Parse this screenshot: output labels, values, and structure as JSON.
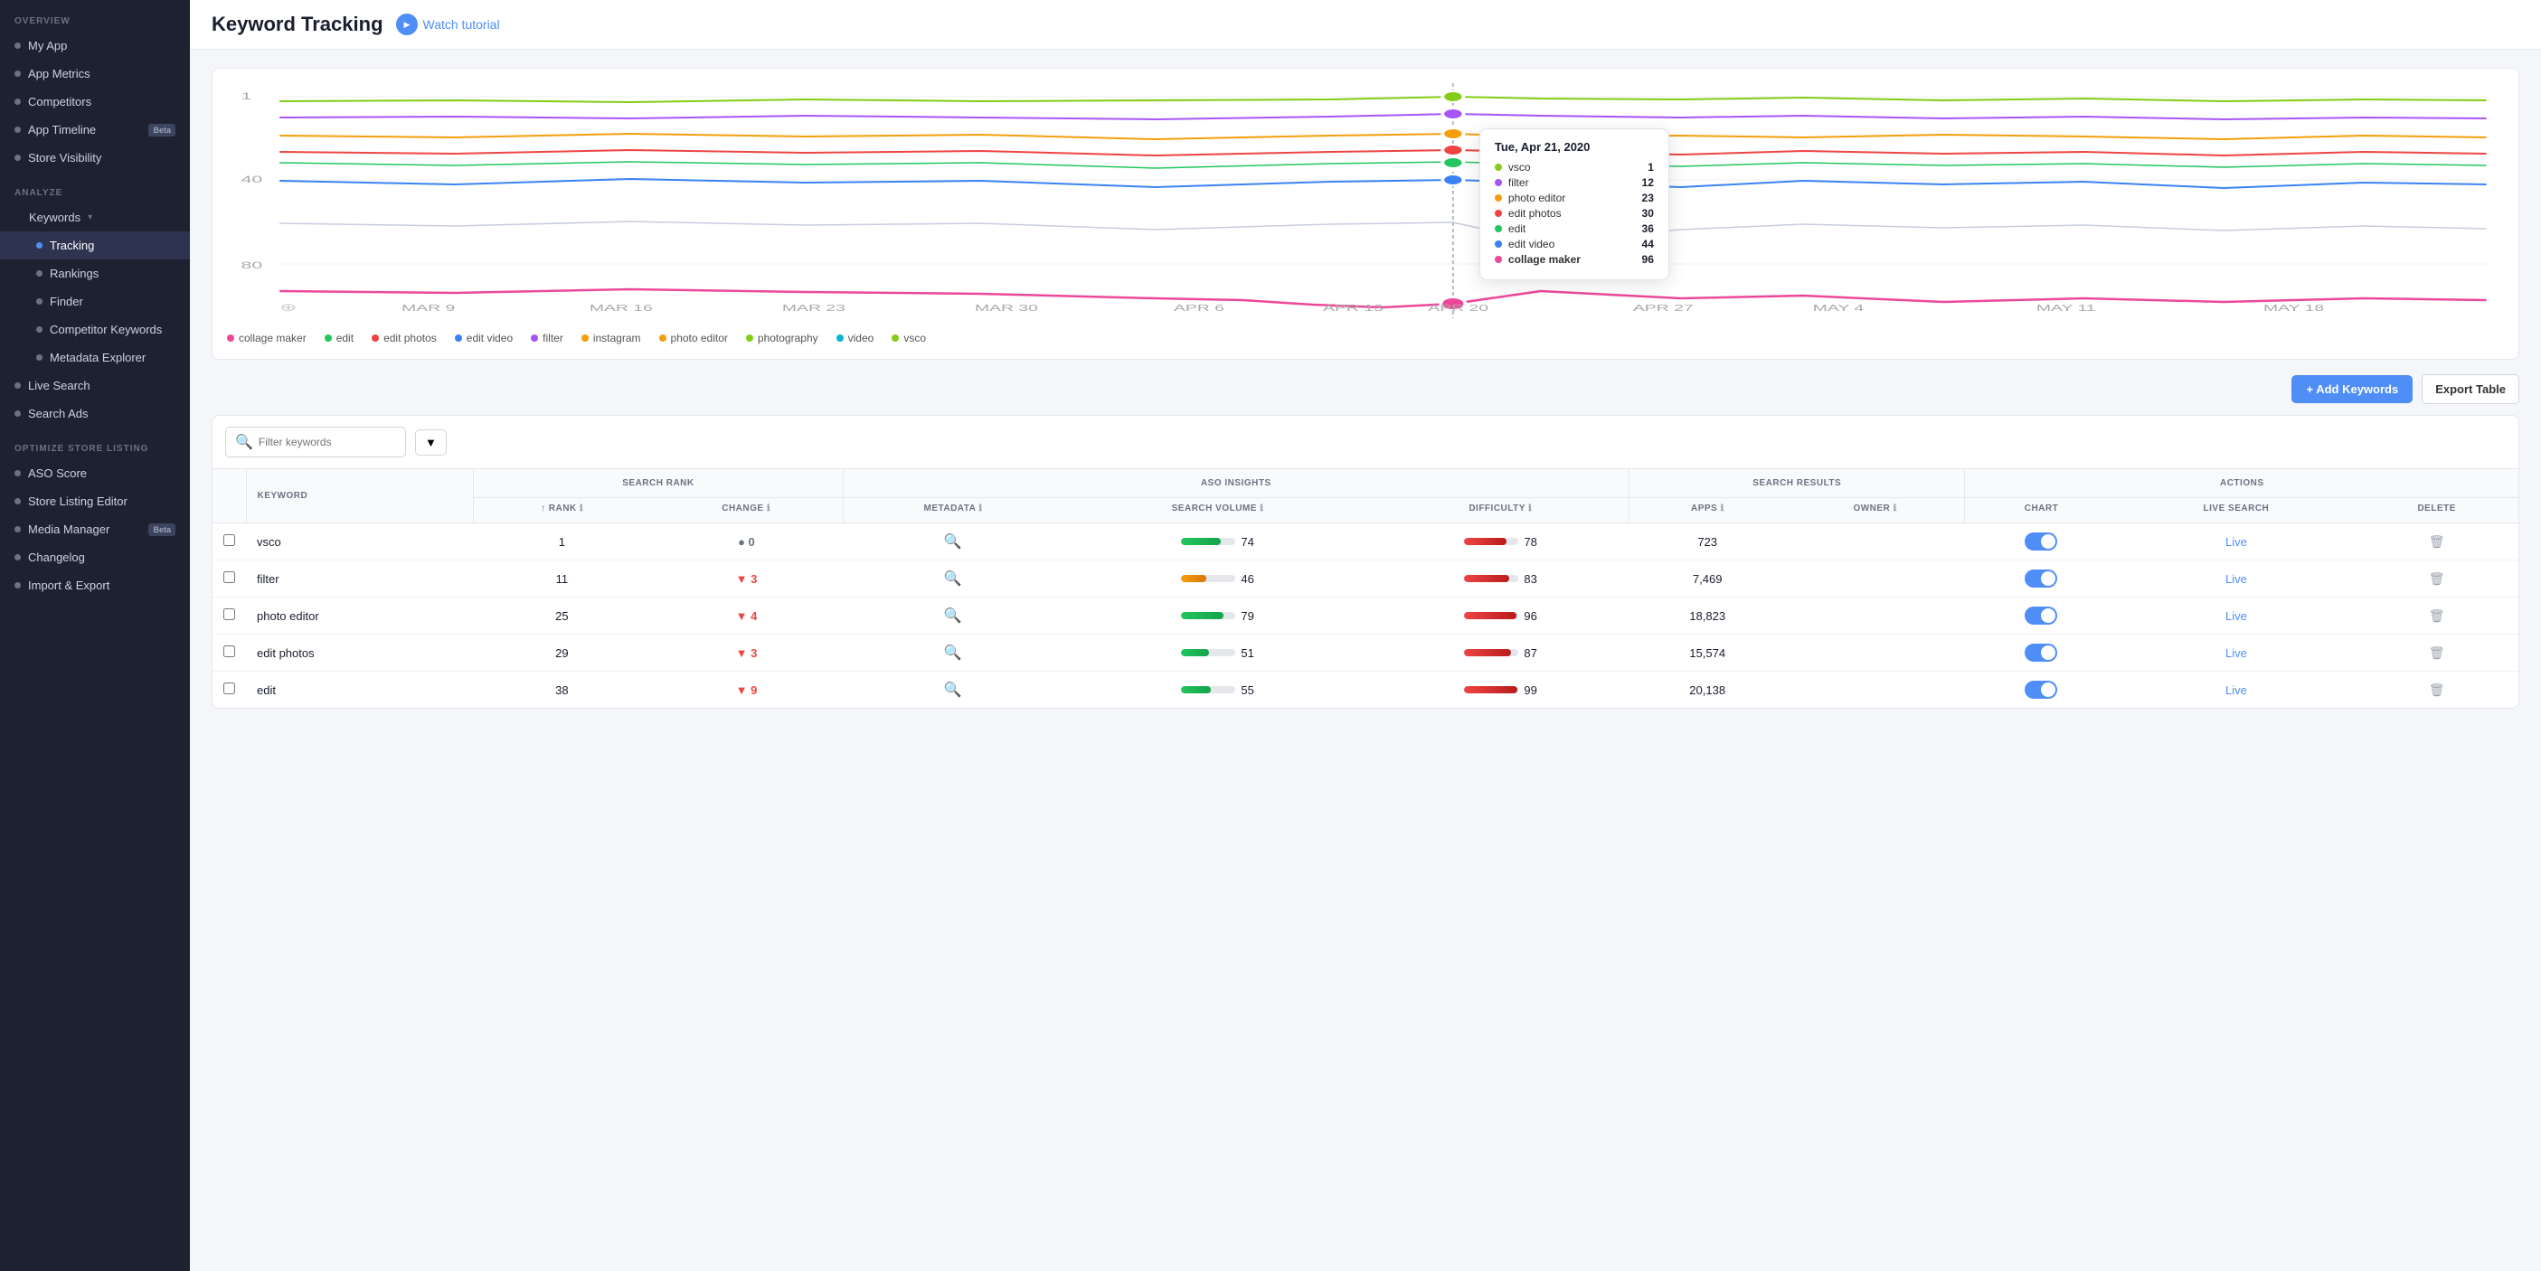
{
  "sidebar": {
    "overview_label": "OVERVIEW",
    "analyze_label": "ANALYZE",
    "optimize_label": "OPTIMIZE STORE LISTING",
    "items_overview": [
      {
        "label": "My App",
        "name": "my-app"
      },
      {
        "label": "App Metrics",
        "name": "app-metrics"
      },
      {
        "label": "Competitors",
        "name": "competitors"
      },
      {
        "label": "App Timeline",
        "name": "app-timeline",
        "badge": "Beta"
      },
      {
        "label": "Store Visibility",
        "name": "store-visibility"
      }
    ],
    "keywords_label": "Keywords",
    "keywords_sub": [
      {
        "label": "Tracking",
        "name": "tracking",
        "active": true
      },
      {
        "label": "Rankings",
        "name": "rankings"
      },
      {
        "label": "Finder",
        "name": "finder"
      },
      {
        "label": "Competitor Keywords",
        "name": "competitor-keywords"
      },
      {
        "label": "Metadata Explorer",
        "name": "metadata-explorer"
      }
    ],
    "items_analyze_extra": [
      {
        "label": "Live Search",
        "name": "live-search"
      },
      {
        "label": "Search Ads",
        "name": "search-ads"
      }
    ],
    "items_optimize": [
      {
        "label": "ASO Score",
        "name": "aso-score"
      },
      {
        "label": "Store Listing Editor",
        "name": "store-listing-editor"
      },
      {
        "label": "Media Manager",
        "name": "media-manager",
        "badge": "Beta"
      },
      {
        "label": "Changelog",
        "name": "changelog"
      },
      {
        "label": "Import & Export",
        "name": "import-export"
      }
    ]
  },
  "header": {
    "title": "Keyword Tracking",
    "tutorial_label": "Watch tutorial"
  },
  "chart": {
    "y_labels": [
      "1",
      "40",
      "80"
    ],
    "x_labels": [
      "MAR 9",
      "MAR 16",
      "MAR 23",
      "MAR 30",
      "APR 6",
      "APR 13",
      "APR 20",
      "APR 27",
      "MAY 4",
      "MAY 11",
      "MAY 18"
    ],
    "tooltip": {
      "date": "Tue, Apr 21, 2020",
      "rows": [
        {
          "color": "#84cc16",
          "label": "vsco",
          "value": "1"
        },
        {
          "color": "#a855f7",
          "label": "filter",
          "value": "12"
        },
        {
          "color": "#f59e0b",
          "label": "photo editor",
          "value": "23"
        },
        {
          "color": "#ef4444",
          "label": "edit photos",
          "value": "30"
        },
        {
          "color": "#22c55e",
          "label": "edit",
          "value": "36"
        },
        {
          "color": "#3b82f6",
          "label": "edit video",
          "value": "44"
        },
        {
          "color": "#ec4899",
          "label": "collage maker",
          "value": "96",
          "bold": true
        }
      ]
    }
  },
  "legend": [
    {
      "label": "collage maker",
      "color": "#ec4899"
    },
    {
      "label": "edit",
      "color": "#22c55e"
    },
    {
      "label": "edit photos",
      "color": "#ef4444"
    },
    {
      "label": "edit video",
      "color": "#3b82f6"
    },
    {
      "label": "filter",
      "color": "#a855f7"
    },
    {
      "label": "instagram",
      "color": "#f59e0b"
    },
    {
      "label": "photo editor",
      "color": "#f59e0b"
    },
    {
      "label": "photography",
      "color": "#84cc16"
    },
    {
      "label": "video",
      "color": "#06b6d4"
    },
    {
      "label": "vsco",
      "color": "#84cc16"
    }
  ],
  "toolbar": {
    "add_keywords_label": "+ Add Keywords",
    "export_table_label": "Export Table"
  },
  "filter": {
    "placeholder": "Filter keywords"
  },
  "table": {
    "col_groups": [
      {
        "label": "SEARCH RANK",
        "colspan": 2
      },
      {
        "label": "ASO INSIGHTS",
        "colspan": 3
      },
      {
        "label": "SEARCH RESULTS",
        "colspan": 2
      },
      {
        "label": "ACTIONS",
        "colspan": 3
      }
    ],
    "columns": [
      {
        "label": "KEYWORD"
      },
      {
        "label": "↑ RANK"
      },
      {
        "label": "CHANGE"
      },
      {
        "label": "METADATA"
      },
      {
        "label": "SEARCH VOLUME"
      },
      {
        "label": "DIFFICULTY"
      },
      {
        "label": "APPS"
      },
      {
        "label": "OWNER"
      },
      {
        "label": "CHART"
      },
      {
        "label": "LIVE SEARCH"
      },
      {
        "label": "DELETE"
      }
    ],
    "rows": [
      {
        "keyword": "vsco",
        "rank": "1",
        "change": "0",
        "change_dir": "neutral",
        "search_volume": 74,
        "search_volume_bar": 74,
        "search_volume_color": "green",
        "difficulty": 78,
        "difficulty_bar": 78,
        "difficulty_color": "red",
        "apps": "723",
        "owner": "",
        "toggle": true,
        "live": "Live"
      },
      {
        "keyword": "filter",
        "rank": "11",
        "change": "3",
        "change_dir": "down",
        "search_volume": 46,
        "search_volume_bar": 46,
        "search_volume_color": "yellow",
        "difficulty": 83,
        "difficulty_bar": 83,
        "difficulty_color": "red",
        "apps": "7,469",
        "owner": "",
        "toggle": true,
        "live": "Live"
      },
      {
        "keyword": "photo editor",
        "rank": "25",
        "change": "4",
        "change_dir": "down",
        "search_volume": 79,
        "search_volume_bar": 79,
        "search_volume_color": "green",
        "difficulty": 96,
        "difficulty_bar": 96,
        "difficulty_color": "red",
        "apps": "18,823",
        "owner": "",
        "toggle": true,
        "live": "Live"
      },
      {
        "keyword": "edit photos",
        "rank": "29",
        "change": "3",
        "change_dir": "down",
        "search_volume": 51,
        "search_volume_bar": 51,
        "search_volume_color": "green",
        "difficulty": 87,
        "difficulty_bar": 87,
        "difficulty_color": "red",
        "apps": "15,574",
        "owner": "",
        "toggle": true,
        "live": "Live"
      },
      {
        "keyword": "edit",
        "rank": "38",
        "change": "9",
        "change_dir": "down",
        "search_volume": 55,
        "search_volume_bar": 55,
        "search_volume_color": "green",
        "difficulty": 99,
        "difficulty_bar": 99,
        "difficulty_color": "red",
        "apps": "20,138",
        "owner": "",
        "toggle": true,
        "live": "Live"
      }
    ]
  }
}
